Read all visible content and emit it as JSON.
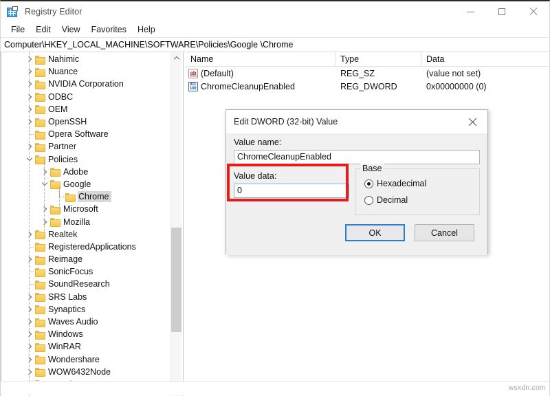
{
  "window": {
    "title": "Registry Editor",
    "icon": "registry-editor-icon",
    "controls": {
      "minimize": "minimize-button",
      "maximize": "maximize-button",
      "close": "close-button"
    }
  },
  "menubar": {
    "items": [
      {
        "label": "File"
      },
      {
        "label": "Edit"
      },
      {
        "label": "View"
      },
      {
        "label": "Favorites"
      },
      {
        "label": "Help"
      }
    ]
  },
  "address": {
    "path": "Computer\\HKEY_LOCAL_MACHINE\\SOFTWARE\\Policies\\Google \\Chrome"
  },
  "tree": {
    "items": [
      {
        "label": "Nahimic",
        "indent": 1,
        "twisty": "right",
        "selected": false
      },
      {
        "label": "Nuance",
        "indent": 1,
        "twisty": "right",
        "selected": false
      },
      {
        "label": "NVIDIA Corporation",
        "indent": 1,
        "twisty": "right",
        "selected": false
      },
      {
        "label": "ODBC",
        "indent": 1,
        "twisty": "right",
        "selected": false
      },
      {
        "label": "OEM",
        "indent": 1,
        "twisty": "right",
        "selected": false
      },
      {
        "label": "OpenSSH",
        "indent": 1,
        "twisty": "right",
        "selected": false
      },
      {
        "label": "Opera Software",
        "indent": 1,
        "twisty": "none",
        "selected": false
      },
      {
        "label": "Partner",
        "indent": 1,
        "twisty": "right",
        "selected": false
      },
      {
        "label": "Policies",
        "indent": 1,
        "twisty": "down",
        "selected": false
      },
      {
        "label": "Adobe",
        "indent": 2,
        "twisty": "right",
        "selected": false
      },
      {
        "label": "Google",
        "indent": 2,
        "twisty": "down",
        "selected": false
      },
      {
        "label": "Chrome",
        "indent": 3,
        "twisty": "none",
        "selected": true
      },
      {
        "label": "Microsoft",
        "indent": 2,
        "twisty": "right",
        "selected": false
      },
      {
        "label": "Mozilla",
        "indent": 2,
        "twisty": "right",
        "selected": false
      },
      {
        "label": "Realtek",
        "indent": 1,
        "twisty": "right",
        "selected": false
      },
      {
        "label": "RegisteredApplications",
        "indent": 1,
        "twisty": "none",
        "selected": false
      },
      {
        "label": "Reimage",
        "indent": 1,
        "twisty": "right",
        "selected": false
      },
      {
        "label": "SonicFocus",
        "indent": 1,
        "twisty": "none",
        "selected": false
      },
      {
        "label": "SoundResearch",
        "indent": 1,
        "twisty": "none",
        "selected": false
      },
      {
        "label": "SRS Labs",
        "indent": 1,
        "twisty": "right",
        "selected": false
      },
      {
        "label": "Synaptics",
        "indent": 1,
        "twisty": "right",
        "selected": false
      },
      {
        "label": "Waves Audio",
        "indent": 1,
        "twisty": "right",
        "selected": false
      },
      {
        "label": "Windows",
        "indent": 1,
        "twisty": "right",
        "selected": false
      },
      {
        "label": "WinRAR",
        "indent": 1,
        "twisty": "right",
        "selected": false
      },
      {
        "label": "Wondershare",
        "indent": 1,
        "twisty": "right",
        "selected": false
      },
      {
        "label": "WOW6432Node",
        "indent": 1,
        "twisty": "right",
        "selected": false
      },
      {
        "label": "Yamaha APO",
        "indent": 1,
        "twisty": "right",
        "selected": false
      }
    ],
    "scrollbar": {
      "up": "scroll-up-icon",
      "down": "scroll-down-icon"
    }
  },
  "list": {
    "columns": [
      "Name",
      "Type",
      "Data"
    ],
    "rows": [
      {
        "icon": "reg-sz-icon",
        "name": "(Default)",
        "type": "REG_SZ",
        "data": "(value not set)"
      },
      {
        "icon": "reg-dword-icon",
        "name": "ChromeCleanupEnabled",
        "type": "REG_DWORD",
        "data": "0x00000000 (0)"
      }
    ]
  },
  "dialog": {
    "title": "Edit DWORD (32-bit) Value",
    "close_icon": "dialog-close-icon",
    "value_name": {
      "label": "Value name:",
      "value": "ChromeCleanupEnabled"
    },
    "value_data": {
      "label": "Value data:",
      "value": "0"
    },
    "base": {
      "legend": "Base",
      "options": [
        {
          "label": "Hexadecimal",
          "checked": true
        },
        {
          "label": "Decimal",
          "checked": false
        }
      ]
    },
    "buttons": {
      "ok": "OK",
      "cancel": "Cancel"
    }
  },
  "annotation": {
    "color": "#e81b1b"
  },
  "status": {
    "watermark": "wsxdn.com"
  }
}
